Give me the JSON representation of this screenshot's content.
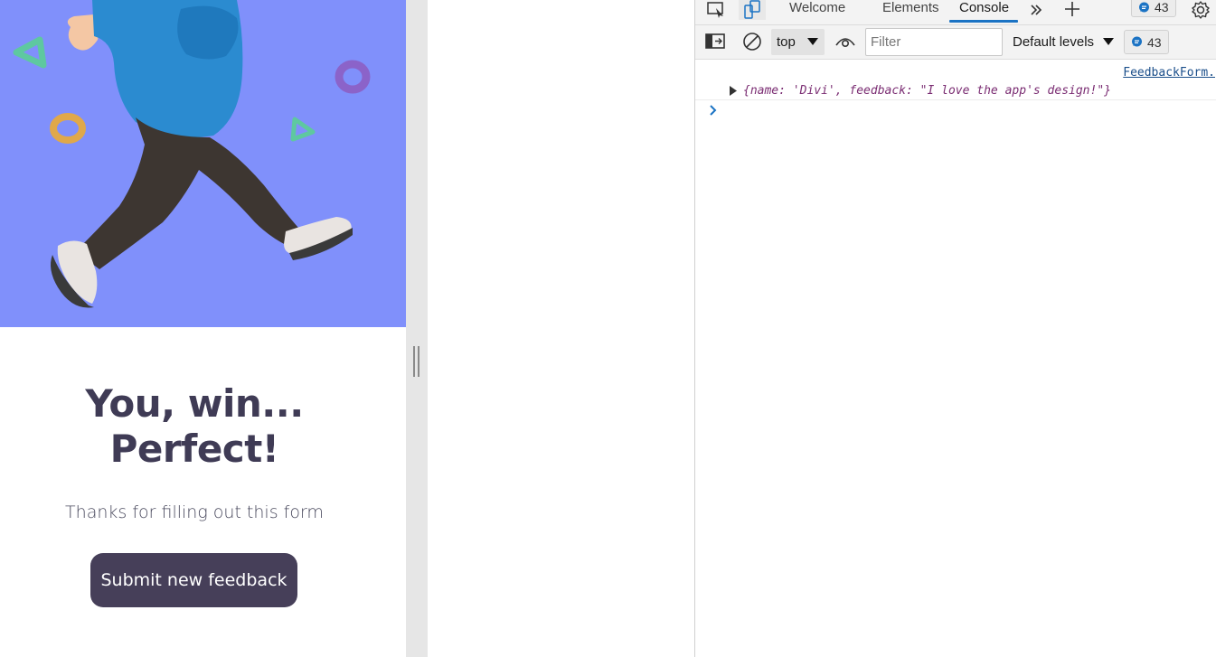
{
  "app": {
    "title_line1": "You, win...",
    "title_line2": "Perfect!",
    "message": "Thanks for filling out this form",
    "submit_new_label": "Submit new feedback",
    "hero_bg_color": "#8090fb",
    "button_color": "#463f59"
  },
  "devtools": {
    "tabs": [
      {
        "label": "Welcome"
      },
      {
        "label": "Elements"
      },
      {
        "label": "Console"
      }
    ],
    "active_tab": "Console",
    "issues_count_top": "43",
    "issues_count_toolbar": "43",
    "context": "top",
    "filter_placeholder": "Filter",
    "levels": "Default levels",
    "log": {
      "source": "FeedbackForm.",
      "text": "{name: 'Divi', feedback: \"I love the app's design!\"}"
    },
    "accent_color": "#1b73c4"
  }
}
